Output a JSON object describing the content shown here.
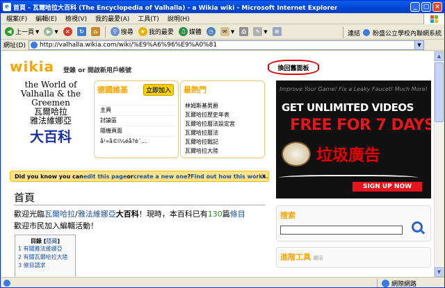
{
  "window": {
    "title": "首頁 - 瓦爾哈拉大百科 (The Encyclopedia of Valhalla) - a Wikia wiki - Microsoft Internet Explorer",
    "app_icon": "e"
  },
  "menu": [
    "檔案(F)",
    "編輯(E)",
    "檢視(V)",
    "我的最愛(A)",
    "工具(T)",
    "說明(H)"
  ],
  "toolbar": {
    "back": "上一頁",
    "search": "搜尋",
    "favorites": "我的最愛",
    "media": "媒體",
    "links_label": "連結",
    "link_item": "盼盛公立學校內聯網系統"
  },
  "address": {
    "label": "網址(D)",
    "url": "http://valhalla.wikia.com/wiki/%E9%A6%96%E9%A0%81"
  },
  "status": {
    "text": "",
    "zone": "網際網路"
  },
  "page": {
    "logo": "wikia",
    "login_a": "登錄",
    "login_or": "or",
    "login_b": "開啟新用戶帳號",
    "return_button": "換回舊面板",
    "valhalla_logo": {
      "line1": "the World of",
      "line2": "Valhalla & the Greemen",
      "line3": "瓦爾哈拉",
      "line4": "雅法維娜亞",
      "line5": "大百科"
    },
    "community": {
      "heading": "德國維基",
      "join": "立即加入",
      "items": [
        "主頁",
        "討論區",
        "隨機頁面",
        "å¹«å©ï¼éå?è¨..."
      ]
    },
    "popular": {
      "heading": "最熱門",
      "items": [
        "林姆斯基男爵",
        "瓦爾哈拉歷史年表",
        "瓦爾哈拉曆法設定宮",
        "瓦爾哈拉曆法",
        "瓦爾哈拉戰記",
        "瓦爾哈拉大陸"
      ]
    },
    "dyk": {
      "a": "Did you know you can ",
      "link1": "edit this page",
      "b": " or ",
      "link2": "create a new one",
      "c": "? ",
      "link3": "Find out how this works.",
      "close": "x"
    },
    "ad": {
      "tagline": "Improve Your Game! Fix a Leaky Faucet! Much More!",
      "line1": "GET UNLIMITED VIDEOS",
      "line2": "FREE FOR 7 DAYS",
      "annotation": "垃圾廣告",
      "signup": "SIGN UP NOW"
    },
    "heading": "首頁",
    "intro": {
      "p1": "歡迎光臨",
      "link1": "瓦爾哈拉",
      "slash": "/",
      "link2": "雅法維娜亞",
      "p2": "大百科",
      "p3": "！現時，本百科已有",
      "count": "130",
      "p4": "篇",
      "link3": "條目",
      "p5": "歡迎市民加入編輯活動！"
    },
    "toc": {
      "title": "目錄",
      "hide": "隱藏",
      "items": [
        "1 有關雅法維娜亞",
        "2 有關瓦爾哈拉大陸",
        "3 條目請求"
      ]
    },
    "search": {
      "heading": "搜索"
    },
    "advanced_tools": {
      "heading": "進階工具",
      "show": "顯示"
    }
  }
}
